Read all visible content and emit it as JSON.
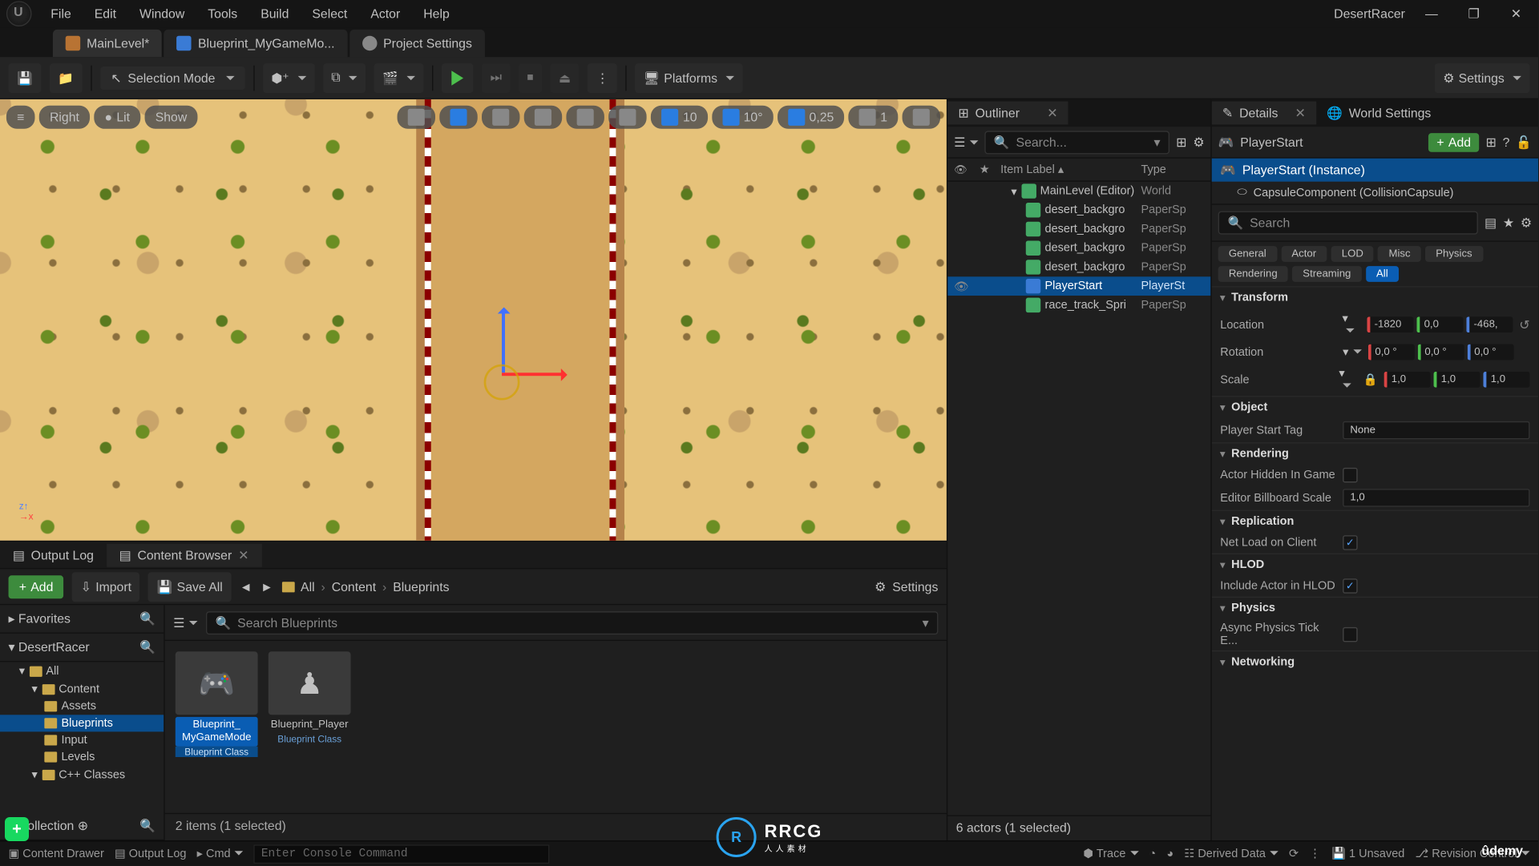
{
  "project_name": "DesertRacer",
  "menu": [
    "File",
    "Edit",
    "Window",
    "Tools",
    "Build",
    "Select",
    "Actor",
    "Help"
  ],
  "doc_tabs": [
    {
      "label": "MainLevel*",
      "icon": "orange",
      "active": true
    },
    {
      "label": "Blueprint_MyGameMo...",
      "icon": "blue",
      "active": false
    },
    {
      "label": "Project Settings",
      "icon": "gear",
      "active": false
    }
  ],
  "toolbar": {
    "selection_mode": "Selection Mode",
    "platforms": "Platforms",
    "settings": "Settings"
  },
  "viewport": {
    "left_pills": [
      "Right",
      "Lit",
      "Show"
    ],
    "right_pills": [
      {
        "v": "10",
        "icon": "grid"
      },
      {
        "v": "10°",
        "icon": "angle"
      },
      {
        "v": "0,25",
        "icon": "scale"
      },
      {
        "v": "1",
        "icon": "camera"
      }
    ]
  },
  "bottom_tabs": [
    {
      "label": "Output Log",
      "active": false
    },
    {
      "label": "Content Browser",
      "active": true,
      "close": true
    }
  ],
  "content_browser": {
    "add": "Add",
    "import": "Import",
    "save_all": "Save All",
    "breadcrumb": [
      "All",
      "Content",
      "Blueprints"
    ],
    "settings": "Settings",
    "search_placeholder": "Search Blueprints",
    "favorites": "Favorites",
    "project": "DesertRacer",
    "collection": "Collection",
    "tree": [
      {
        "label": "All",
        "depth": 0,
        "exp": true
      },
      {
        "label": "Content",
        "depth": 1,
        "exp": true
      },
      {
        "label": "Assets",
        "depth": 2
      },
      {
        "label": "Blueprints",
        "depth": 2,
        "selected": true
      },
      {
        "label": "Input",
        "depth": 2
      },
      {
        "label": "Levels",
        "depth": 2
      },
      {
        "label": "C++ Classes",
        "depth": 1,
        "exp": true
      }
    ],
    "assets": [
      {
        "name": "Blueprint_MyGameMode",
        "type": "Blueprint Class",
        "selected": true,
        "thumb": "gamemode"
      },
      {
        "name": "Blueprint_Player",
        "type": "Blueprint Class",
        "selected": false,
        "thumb": "pawn"
      }
    ],
    "status": "2 items (1 selected)"
  },
  "outliner": {
    "tab": "Outliner",
    "search_placeholder": "Search...",
    "header": {
      "label": "Item Label",
      "type": "Type"
    },
    "rows": [
      {
        "name": "MainLevel (Editor)",
        "type": "World",
        "kind": "world",
        "indent": 0
      },
      {
        "name": "desert_backgro",
        "type": "PaperSp",
        "kind": "sprite",
        "indent": 1
      },
      {
        "name": "desert_backgro",
        "type": "PaperSp",
        "kind": "sprite",
        "indent": 1
      },
      {
        "name": "desert_backgro",
        "type": "PaperSp",
        "kind": "sprite",
        "indent": 1
      },
      {
        "name": "desert_backgro",
        "type": "PaperSp",
        "kind": "sprite",
        "indent": 1
      },
      {
        "name": "PlayerStart",
        "type": "PlayerSt",
        "kind": "ps",
        "indent": 1,
        "selected": true,
        "vis": true
      },
      {
        "name": "race_track_Spri",
        "type": "PaperSp",
        "kind": "sprite",
        "indent": 1
      }
    ],
    "status": "6 actors (1 selected)"
  },
  "details": {
    "tab": "Details",
    "world_tab": "World Settings",
    "actor": "PlayerStart",
    "add": "Add",
    "instance": "PlayerStart (Instance)",
    "component": "CapsuleComponent (CollisionCapsule)",
    "search_placeholder": "Search",
    "categories": [
      "General",
      "Actor",
      "LOD",
      "Misc",
      "Physics",
      "Rendering",
      "Streaming",
      "All"
    ],
    "active_category": "All",
    "transform": {
      "title": "Transform",
      "location_label": "Location",
      "location": [
        "-1820",
        "0,0",
        "-468,"
      ],
      "rotation_label": "Rotation",
      "rotation": [
        "0,0 °",
        "0,0 °",
        "0,0 °"
      ],
      "scale_label": "Scale",
      "scale": [
        "1,0",
        "1,0",
        "1,0"
      ]
    },
    "sections": [
      {
        "title": "Object",
        "props": [
          {
            "label": "Player Start Tag",
            "type": "text",
            "value": "None"
          }
        ]
      },
      {
        "title": "Rendering",
        "props": [
          {
            "label": "Actor Hidden In Game",
            "type": "check",
            "value": false
          },
          {
            "label": "Editor Billboard Scale",
            "type": "text",
            "value": "1,0"
          }
        ]
      },
      {
        "title": "Replication",
        "props": [
          {
            "label": "Net Load on Client",
            "type": "check",
            "value": true
          }
        ]
      },
      {
        "title": "HLOD",
        "props": [
          {
            "label": "Include Actor in HLOD",
            "type": "check",
            "value": true
          }
        ]
      },
      {
        "title": "Physics",
        "props": [
          {
            "label": "Async Physics Tick E...",
            "type": "check",
            "value": false
          }
        ]
      },
      {
        "title": "Networking",
        "props": []
      }
    ]
  },
  "statusbar": {
    "content_drawer": "Content Drawer",
    "output_log": "Output Log",
    "cmd_label": "Cmd",
    "cmd_placeholder": "Enter Console Command",
    "trace": "Trace",
    "derived": "Derived Data",
    "unsaved": "1 Unsaved",
    "revision": "Revision Control"
  },
  "overlay": {
    "udemy": "ûdemy",
    "rrcg": "RRCG",
    "rrcg_sub": "人人素材"
  }
}
